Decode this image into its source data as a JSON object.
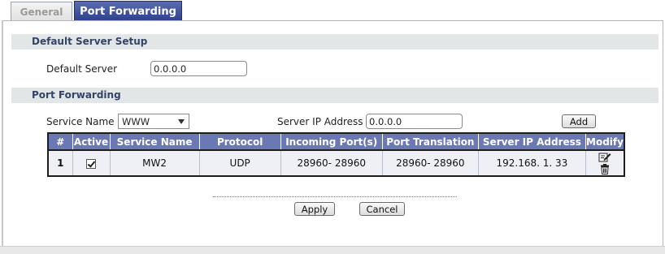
{
  "tabs": [
    {
      "label": "General",
      "active": false
    },
    {
      "label": "Port Forwarding",
      "active": true
    }
  ],
  "default_server_setup": {
    "header": "Default Server Setup",
    "label": "Default Server",
    "value": "0.0.0.0"
  },
  "port_forwarding": {
    "header": "Port Forwarding",
    "service_name_label": "Service Name",
    "service_name_selected": "WWW",
    "server_ip_label": "Server IP Address",
    "server_ip_value": "0.0.0.0",
    "add_label": "Add"
  },
  "table": {
    "columns": [
      "#",
      "Active",
      "Service Name",
      "Protocol",
      "Incoming Port(s)",
      "Port Translation",
      "Server IP Address",
      "Modify"
    ],
    "rows": [
      {
        "num": "1",
        "active": true,
        "service_name": "MW2",
        "protocol": "UDP",
        "incoming": "28960- 28960",
        "translation": "28960- 28960",
        "server_ip": "192.168. 1. 33"
      }
    ]
  },
  "actions": {
    "apply_label": "Apply",
    "cancel_label": "Cancel"
  },
  "colors": {
    "active_tab": "#3a4a97",
    "table_header": "#6a79b4",
    "section_header_bg": "#e3e6e6"
  },
  "icons": {
    "edit": "edit-icon",
    "delete": "trash-icon"
  }
}
